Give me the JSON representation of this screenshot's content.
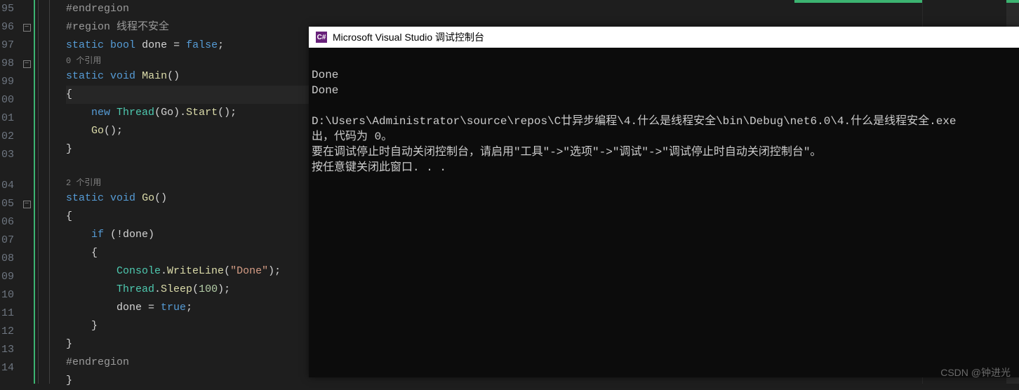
{
  "editor": {
    "line_numbers": [
      "95",
      "96",
      "97",
      "98",
      "99",
      "00",
      "01",
      "02",
      "03",
      "",
      "04",
      "05",
      "06",
      "07",
      "08",
      "09",
      "10",
      "11",
      "12",
      "13",
      "14"
    ],
    "endregion": "#endregion",
    "region": "#region 线程不安全",
    "decl_static": "static",
    "decl_bool": "bool",
    "decl_void": "void",
    "done_var": "done",
    "equals": " = ",
    "false_lit": "false",
    "semicolon": ";",
    "ref0": "0 个引用",
    "ref2": "2 个引用",
    "main": "Main",
    "go": "Go",
    "new_kw": "new",
    "thread_cls": "Thread",
    "start": "Start",
    "if_kw": "if",
    "not_done": "(!done)",
    "console_cls": "Console",
    "writeline": "WriteLine",
    "done_str": "\"Done\"",
    "sleep": "Sleep",
    "num100": "100",
    "true_lit": "true",
    "brace_open": "{",
    "brace_close": "}",
    "parens": "()"
  },
  "console": {
    "title": "Microsoft Visual Studio 调试控制台",
    "line1": "Done",
    "line2": "Done",
    "line3": "",
    "line4": "D:\\Users\\Administrator\\source\\repos\\C廿异步编程\\4.什么是线程安全\\bin\\Debug\\net6.0\\4.什么是线程安全.exe",
    "line5": "出，代码为 0。",
    "line6": "要在调试停止时自动关闭控制台，请启用\"工具\"->\"选项\"->\"调试\"->\"调试停止时自动关闭控制台\"。",
    "line7": "按任意键关闭此窗口. . ."
  },
  "watermark": "CSDN @钟进光"
}
